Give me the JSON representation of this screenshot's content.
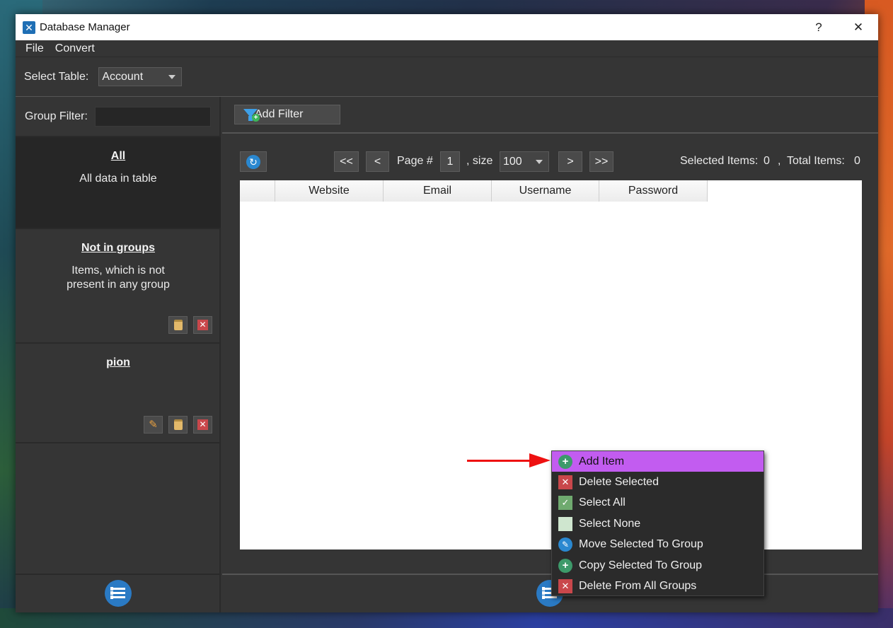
{
  "window": {
    "title": "Database Manager",
    "help_label": "?",
    "close_label": "✕"
  },
  "menu": {
    "items": [
      "File",
      "Convert"
    ]
  },
  "table_select": {
    "label": "Select Table:",
    "value": "Account"
  },
  "group_filter": {
    "label": "Group Filter:",
    "value": ""
  },
  "groups": [
    {
      "name": "All",
      "description_line1": "All data in table",
      "description_line2": ""
    },
    {
      "name": "Not in groups",
      "description_line1": "Items, which is not",
      "description_line2": "present in any group"
    },
    {
      "name": "pion",
      "description_line1": "",
      "description_line2": ""
    }
  ],
  "filter": {
    "add_label": "Add Filter"
  },
  "pager": {
    "first_label": "<<",
    "prev_label": "<",
    "page_label": "Page #",
    "page_value": "1",
    "size_label": ", size",
    "size_value": "100",
    "next_label": ">",
    "last_label": ">>",
    "selected_label": "Selected Items:",
    "selected_value": "0",
    "separator": ",",
    "total_label": "Total Items:",
    "total_value": "0"
  },
  "table": {
    "columns": [
      "Website",
      "Email",
      "Username",
      "Password"
    ]
  },
  "context_menu": {
    "items": [
      {
        "label": "Add Item",
        "icon": "add-icon"
      },
      {
        "label": "Delete Selected",
        "icon": "delete-icon"
      },
      {
        "label": "Select All",
        "icon": "check-icon"
      },
      {
        "label": "Select None",
        "icon": "empty-box-icon"
      },
      {
        "label": "Move Selected To Group",
        "icon": "pencil-icon"
      },
      {
        "label": "Copy Selected To Group",
        "icon": "add-icon"
      },
      {
        "label": "Delete From All Groups",
        "icon": "delete-icon"
      }
    ]
  },
  "colors": {
    "accent": "#c25cf0",
    "panel": "#353535",
    "selected_group": "#262626",
    "annotation_arrow": "#e11111"
  }
}
